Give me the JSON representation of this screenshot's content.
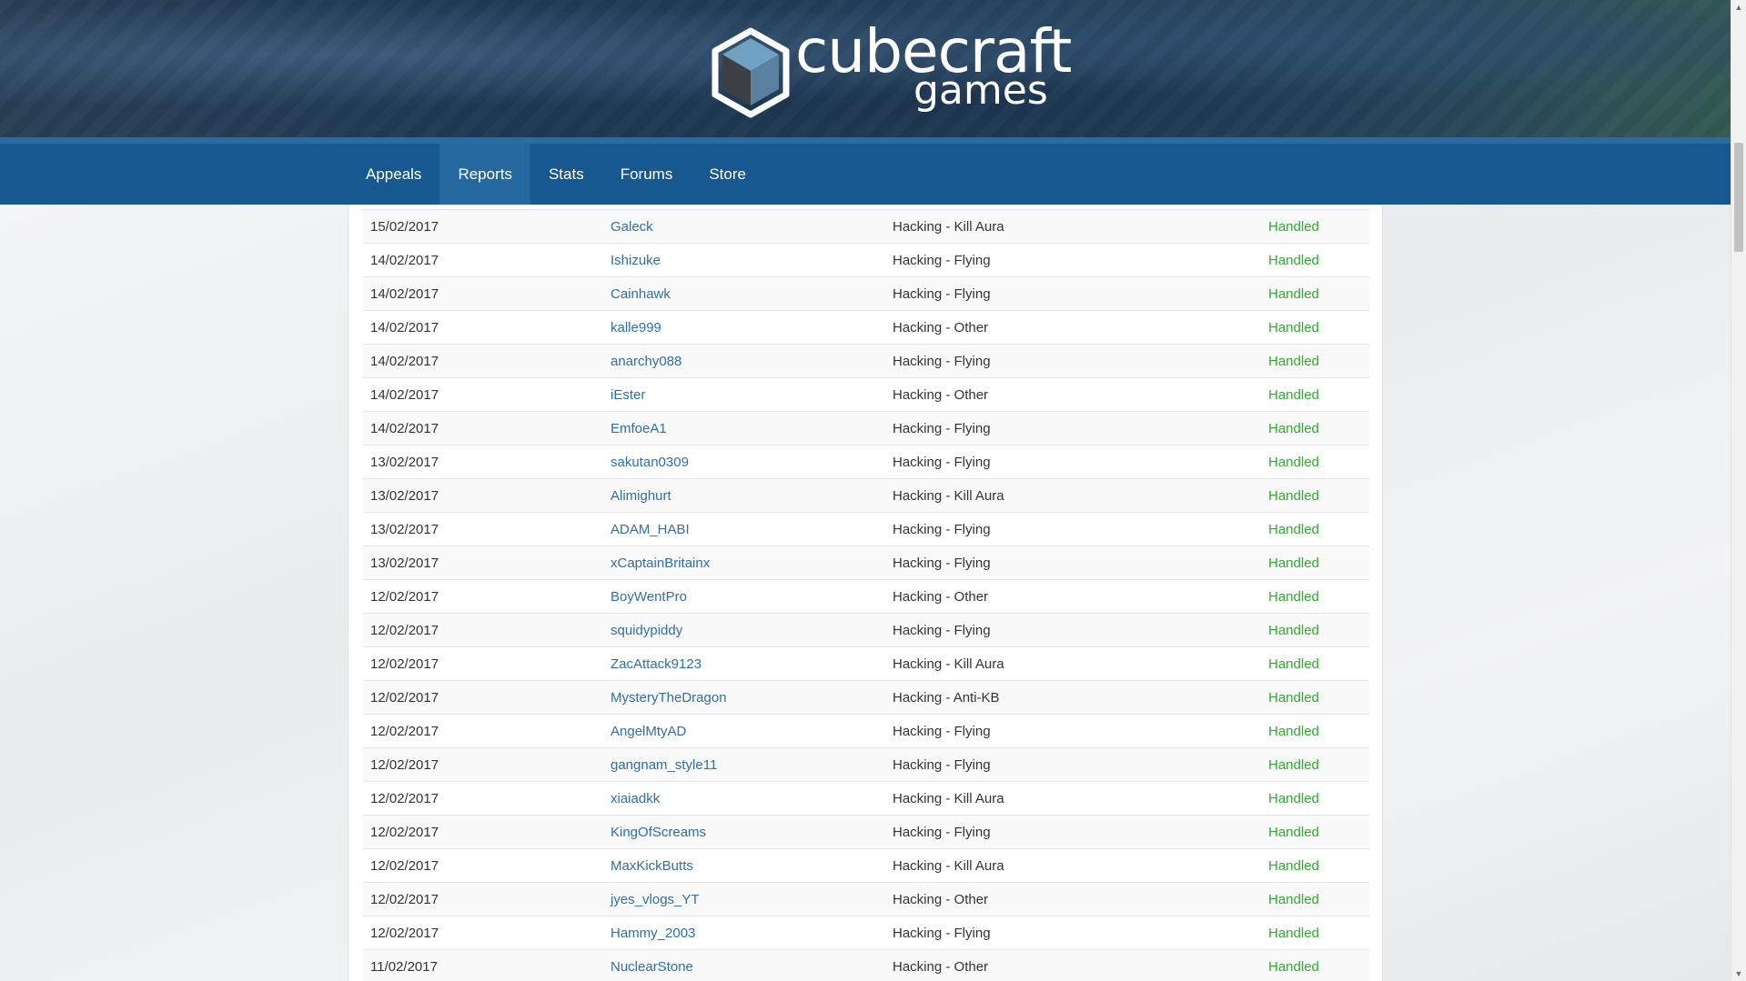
{
  "brand": {
    "logo_line1": "cubecraft",
    "logo_line2": "games",
    "cube_colors": {
      "top": "#6fa2c2",
      "left": "#3c3f44",
      "right": "#5b7f9e",
      "outline": "#ffffff"
    }
  },
  "nav": {
    "items": [
      {
        "label": "Appeals",
        "active": false
      },
      {
        "label": "Reports",
        "active": true
      },
      {
        "label": "Stats",
        "active": false
      },
      {
        "label": "Forums",
        "active": false
      },
      {
        "label": "Store",
        "active": false
      }
    ]
  },
  "colors": {
    "nav_bg": "#175890",
    "link": "#2e6fa7",
    "status_handled": "#2eab2e"
  },
  "reports": {
    "rows": [
      {
        "date": "15/02/2017",
        "player": "Galeck",
        "reason": "Hacking - Kill Aura",
        "status": "Handled"
      },
      {
        "date": "14/02/2017",
        "player": "Ishizuke",
        "reason": "Hacking - Flying",
        "status": "Handled"
      },
      {
        "date": "14/02/2017",
        "player": "Cainhawk",
        "reason": "Hacking - Flying",
        "status": "Handled"
      },
      {
        "date": "14/02/2017",
        "player": "kalle999",
        "reason": "Hacking - Other",
        "status": "Handled"
      },
      {
        "date": "14/02/2017",
        "player": "anarchy088",
        "reason": "Hacking - Flying",
        "status": "Handled"
      },
      {
        "date": "14/02/2017",
        "player": "iEster",
        "reason": "Hacking - Other",
        "status": "Handled"
      },
      {
        "date": "14/02/2017",
        "player": "EmfoeA1",
        "reason": "Hacking - Flying",
        "status": "Handled"
      },
      {
        "date": "13/02/2017",
        "player": "sakutan0309",
        "reason": "Hacking - Flying",
        "status": "Handled"
      },
      {
        "date": "13/02/2017",
        "player": "Alimighurt",
        "reason": "Hacking - Kill Aura",
        "status": "Handled"
      },
      {
        "date": "13/02/2017",
        "player": "ADAM_HABI",
        "reason": "Hacking - Flying",
        "status": "Handled"
      },
      {
        "date": "13/02/2017",
        "player": "xCaptainBritainx",
        "reason": "Hacking - Flying",
        "status": "Handled"
      },
      {
        "date": "12/02/2017",
        "player": "BoyWentPro",
        "reason": "Hacking - Other",
        "status": "Handled"
      },
      {
        "date": "12/02/2017",
        "player": "squidypiddy",
        "reason": "Hacking - Flying",
        "status": "Handled"
      },
      {
        "date": "12/02/2017",
        "player": "ZacAttack9123",
        "reason": "Hacking - Kill Aura",
        "status": "Handled"
      },
      {
        "date": "12/02/2017",
        "player": "MysteryTheDragon",
        "reason": "Hacking - Anti-KB",
        "status": "Handled"
      },
      {
        "date": "12/02/2017",
        "player": "AngelMtyAD",
        "reason": "Hacking - Flying",
        "status": "Handled"
      },
      {
        "date": "12/02/2017",
        "player": "gangnam_style11",
        "reason": "Hacking - Flying",
        "status": "Handled"
      },
      {
        "date": "12/02/2017",
        "player": "xiaiadkk",
        "reason": "Hacking - Kill Aura",
        "status": "Handled"
      },
      {
        "date": "12/02/2017",
        "player": "KingOfScreams",
        "reason": "Hacking - Flying",
        "status": "Handled"
      },
      {
        "date": "12/02/2017",
        "player": "MaxKickButts",
        "reason": "Hacking - Kill Aura",
        "status": "Handled"
      },
      {
        "date": "12/02/2017",
        "player": "jyes_vlogs_YT",
        "reason": "Hacking - Other",
        "status": "Handled"
      },
      {
        "date": "12/02/2017",
        "player": "Hammy_2003",
        "reason": "Hacking - Flying",
        "status": "Handled"
      },
      {
        "date": "11/02/2017",
        "player": "NuclearStone",
        "reason": "Hacking - Other",
        "status": "Handled"
      }
    ]
  }
}
